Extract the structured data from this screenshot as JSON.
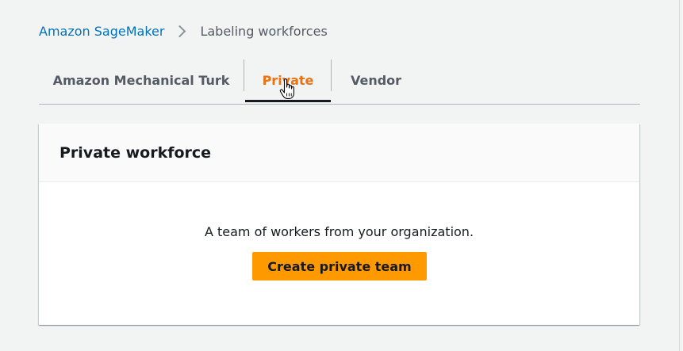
{
  "breadcrumb": {
    "parent": "Amazon SageMaker",
    "current": "Labeling workforces"
  },
  "tabs": [
    {
      "label": "Amazon Mechanical Turk",
      "selected": false
    },
    {
      "label": "Private",
      "selected": true
    },
    {
      "label": "Vendor",
      "selected": false
    }
  ],
  "panel": {
    "title": "Private workforce",
    "description": "A team of workers from your organization.",
    "button_label": "Create private team"
  },
  "cursor": {
    "icon": "hand-pointer-icon"
  },
  "colors": {
    "link": "#0073bb",
    "active_tab": "#ec7211",
    "primary_button": "#ff9900",
    "background": "#f2f3f3"
  }
}
